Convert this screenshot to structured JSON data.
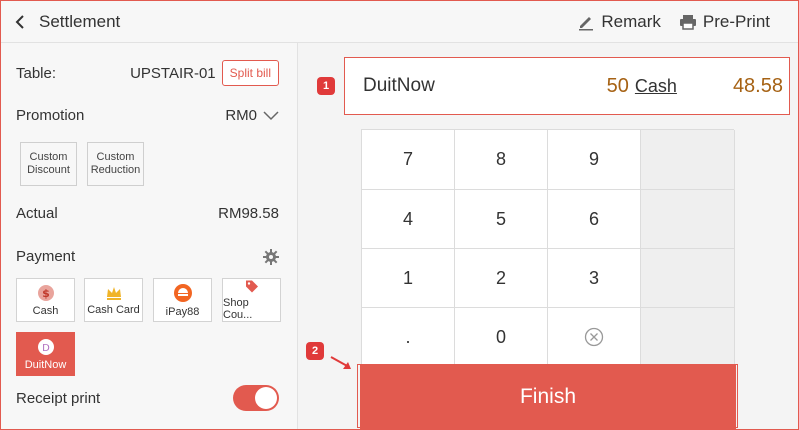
{
  "header": {
    "title": "Settlement",
    "remark_label": "Remark",
    "preprint_label": "Pre-Print"
  },
  "left": {
    "table_label": "Table:",
    "table_value": "UPSTAIR-01",
    "split_bill_label": "Split bill",
    "promotion_label": "Promotion",
    "promotion_value": "RM0",
    "custom_discount_line1": "Custom",
    "custom_discount_line2": "Discount",
    "custom_reduction_line1": "Custom",
    "custom_reduction_line2": "Reduction",
    "actual_label": "Actual",
    "actual_value": "RM98.58",
    "payment_label": "Payment",
    "payment_methods": [
      {
        "label": "Cash",
        "icon": "dollar-icon"
      },
      {
        "label": "Cash Card",
        "icon": "crown-icon"
      },
      {
        "label": "iPay88",
        "icon": "ipay88-icon"
      },
      {
        "label": "Shop Cou...",
        "icon": "tag-icon"
      },
      {
        "label": "DuitNow",
        "icon": "duitnow-icon"
      }
    ],
    "receipt_print_label": "Receipt print",
    "receipt_print_on": true
  },
  "right": {
    "method": "DuitNow",
    "amount": "50",
    "amount_label": "Cash",
    "change": "48.58",
    "badge1": "1",
    "badge2": "2",
    "keys": [
      "7",
      "8",
      "9",
      "",
      "4",
      "5",
      "6",
      "",
      "1",
      "2",
      "3",
      "",
      ".",
      "0",
      "",
      ""
    ],
    "finish_label": "Finish"
  },
  "colors": {
    "accent": "#e25a4f",
    "amount": "#a66214",
    "badge": "#e03a3a"
  }
}
